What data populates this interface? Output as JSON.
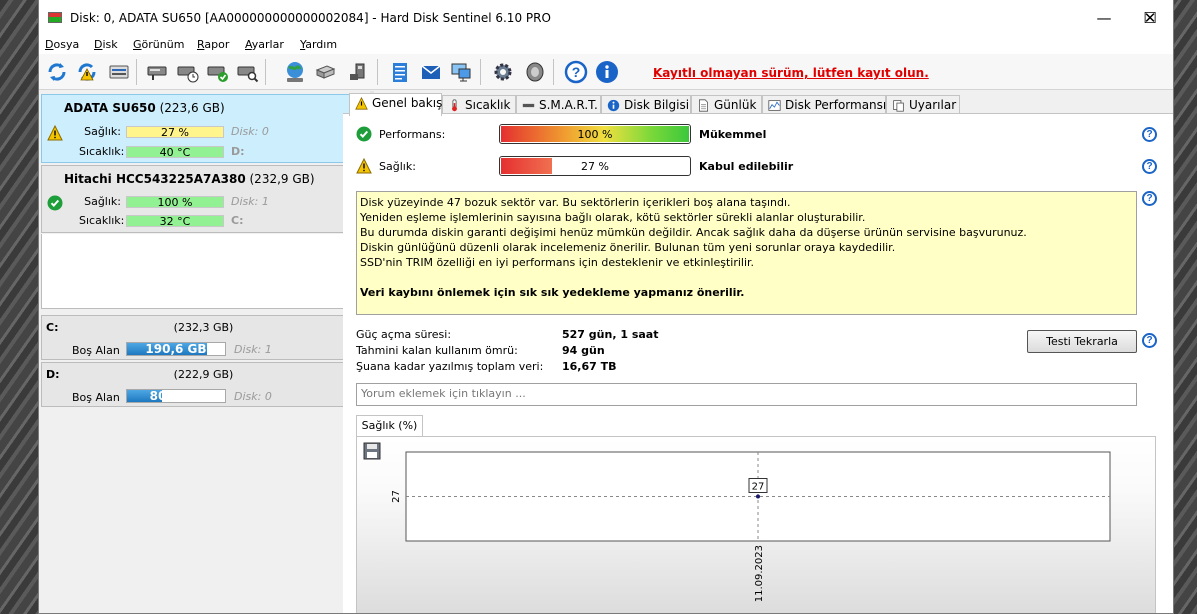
{
  "window": {
    "title": "Disk: 0, ADATA SU650 [AA000000000000002084]  -  Hard Disk Sentinel 6.10 PRO",
    "buttons": {
      "minimize": "—",
      "maximize": "☐",
      "close": "✕"
    }
  },
  "menu": [
    "Dosya",
    "Disk",
    "Görünüm",
    "Rapor",
    "Ayarlar",
    "Yardım"
  ],
  "toolbar": {
    "icons": [
      "refresh-icon",
      "refresh-warning-icon",
      "disk-icon",
      "disk-test-icon",
      "disk-clock-icon",
      "disk-check-icon",
      "disk-search-icon",
      "globe-icon",
      "drive-icon",
      "drive-plug-icon",
      "notepad-icon",
      "mail-icon",
      "network-icon",
      "settings-icon",
      "speaker-icon",
      "help-icon",
      "info-icon"
    ],
    "unregistered_notice": "Kayıtlı olmayan sürüm, lütfen kayıt olun."
  },
  "disks": [
    {
      "name": "ADATA SU650",
      "size": "(223,6 GB)",
      "health_label": "Sağlık:",
      "health": "27 %",
      "health_value": 27,
      "temp_label": "Sıcaklık:",
      "temp": "40 °C",
      "disk_index": "Disk: 0",
      "drive": "D:",
      "status": "warning",
      "selected": true
    },
    {
      "name": "Hitachi HCC543225A7A380",
      "size": "(232,9 GB)",
      "health_label": "Sağlık:",
      "health": "100 %",
      "health_value": 100,
      "temp_label": "Sıcaklık:",
      "temp": "32 °C",
      "disk_index": "Disk: 1",
      "drive": "C:",
      "status": "ok",
      "selected": false
    }
  ],
  "partitions": [
    {
      "letter": "C:",
      "size": "(232,3 GB)",
      "free_label": "Boş Alan",
      "free": "190,6 GB",
      "free_fraction": 0.82,
      "disk": "Disk: 1"
    },
    {
      "letter": "D:",
      "size": "(222,9 GB)",
      "free_label": "Boş Alan",
      "free": "80,7 GB",
      "free_fraction": 0.36,
      "disk": "Disk: 0"
    }
  ],
  "tabs": [
    {
      "label": "Genel bakış",
      "icon": "warning-icon"
    },
    {
      "label": "Sıcaklık",
      "icon": "thermometer-icon"
    },
    {
      "label": "S.M.A.R.T.",
      "icon": "smart-icon"
    },
    {
      "label": "Disk Bilgisi",
      "icon": "info-icon"
    },
    {
      "label": "Günlük",
      "icon": "log-icon"
    },
    {
      "label": "Disk Performansı",
      "icon": "performance-icon"
    },
    {
      "label": "Uyarılar",
      "icon": "alerts-icon"
    }
  ],
  "overview": {
    "performance": {
      "label": "Performans:",
      "value": "100 %",
      "percent": 100,
      "status": "Mükemmel"
    },
    "health": {
      "label": "Sağlık:",
      "value": "27 %",
      "percent": 27,
      "status": "Kabul edilebilir"
    },
    "help": "?",
    "info_lines": [
      "Disk yüzeyinde 47 bozuk sektör var. Bu sektörlerin içerikleri boş alana taşındı.",
      "Yeniden eşleme işlemlerinin sayısına bağlı olarak, kötü sektörler sürekli alanlar oluşturabilir.",
      "Bu durumda diskin garanti değişimi henüz mümkün değildir. Ancak sağlık daha da düşerse ürünün servisine başvurunuz.",
      "Diskin günlüğünü düzenli olarak incelemeniz önerilir. Bulunan tüm yeni sorunlar oraya kaydedilir.",
      "SSD'nin TRIM özelliği en iyi performans için desteklenir ve etkinleştirilir."
    ],
    "info_bold": "Veri kaybını önlemek için sık sık yedekleme yapmanız önerilir.",
    "stats": [
      {
        "label": "Güç açma süresi:",
        "value": "527 gün, 1 saat"
      },
      {
        "label": "Tahmini kalan kullanım ömrü:",
        "value": "94 gün"
      },
      {
        "label": "Şuana kadar yazılmış toplam veri:",
        "value": "16,67 TB"
      }
    ],
    "retest_button": "Testi Tekrarla",
    "comment_placeholder": "Yorum eklemek için tıklayın ..."
  },
  "chart_tab": "Sağlık (%)",
  "chart_data": {
    "type": "line",
    "x": [
      "11.09.2023"
    ],
    "series": [
      {
        "values": [
          27
        ]
      }
    ],
    "ylabel": "",
    "xlabel": "",
    "y_tick_labels": [
      "27"
    ],
    "x_tick_labels": [
      "11.09.2023"
    ],
    "data_labels": [
      "27"
    ],
    "grid": true
  },
  "colors": {
    "warning_link": "#e00000",
    "selected_disk_bg": "#cdeefc",
    "info_box_bg": "#ffffc6",
    "health_yellow": "#fff58c",
    "health_green": "#92f192",
    "free_space_blue": "#1e78c0",
    "help_blue": "#1a64c8"
  }
}
